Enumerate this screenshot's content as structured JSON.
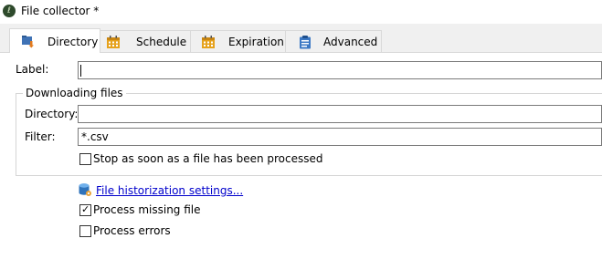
{
  "window": {
    "title": "File collector *",
    "app_icon_glyph": "ℓ"
  },
  "tabs": [
    {
      "label": "Directory",
      "icon": "folder-download-icon",
      "active": true
    },
    {
      "label": "Schedule",
      "icon": "calendar-icon",
      "active": false
    },
    {
      "label": "Expiration",
      "icon": "calendar-icon",
      "active": false
    },
    {
      "label": "Advanced",
      "icon": "clipboard-icon",
      "active": false
    }
  ],
  "form": {
    "label_caption": "Label:",
    "label_value": "",
    "downloading_group": {
      "legend": "Downloading files",
      "directory_caption": "Directory:",
      "directory_value": "",
      "filter_caption": "Filter:",
      "filter_value": "*.csv",
      "stop_checkbox": {
        "label": "Stop as soon as a file has been processed",
        "checked": false
      }
    },
    "historization_link": "File historization settings...",
    "process_missing": {
      "label": "Process missing file",
      "checked": true
    },
    "process_errors": {
      "label": "Process errors",
      "checked": false
    }
  },
  "colors": {
    "link": "#0000cc",
    "panel_bg": "#ffffff",
    "chrome_bg": "#f0f0f0",
    "calendar_icon": "#e6a21c"
  }
}
